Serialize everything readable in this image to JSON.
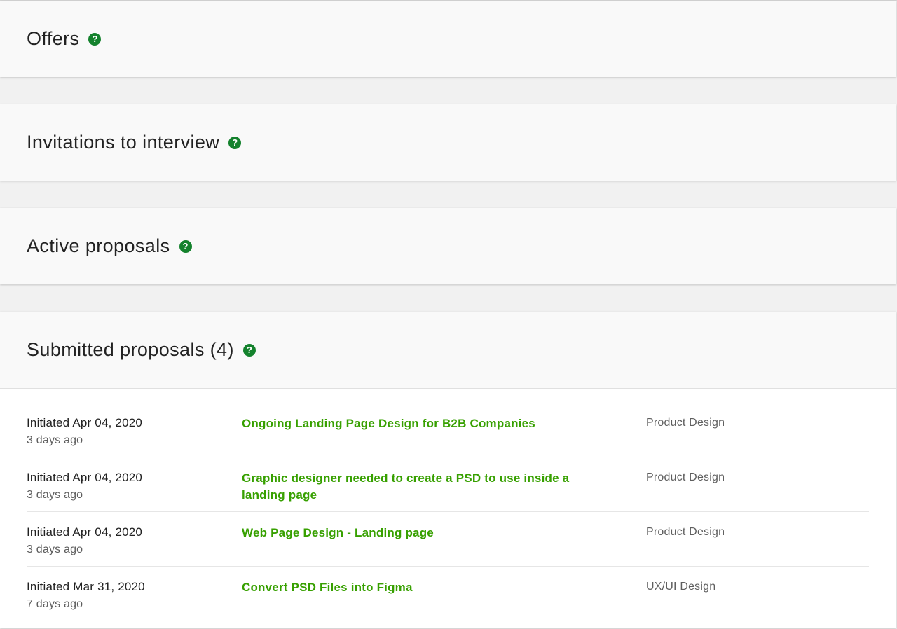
{
  "sections": {
    "offers": {
      "title": "Offers"
    },
    "invitations": {
      "title": "Invitations to interview"
    },
    "active": {
      "title": "Active proposals"
    },
    "submitted": {
      "title": "Submitted proposals (4)"
    }
  },
  "help_icon": {
    "glyph": "?",
    "icon": "question-circle-icon",
    "color": "#14822d"
  },
  "colors": {
    "link": "#37a000",
    "background": "#f1f1f1",
    "card": "#f9f9f9"
  },
  "submitted_proposals": [
    {
      "initiated": "Initiated Apr 04, 2020",
      "ago": "3 days ago",
      "title": "Ongoing Landing Page Design for B2B Companies",
      "category": "Product Design"
    },
    {
      "initiated": "Initiated Apr 04, 2020",
      "ago": "3 days ago",
      "title": "Graphic designer needed to create a PSD to use inside a landing page",
      "category": "Product Design"
    },
    {
      "initiated": "Initiated Apr 04, 2020",
      "ago": "3 days ago",
      "title": "Web Page Design - Landing page",
      "category": "Product Design"
    },
    {
      "initiated": "Initiated Mar 31, 2020",
      "ago": "7 days ago",
      "title": "Convert PSD Files into Figma",
      "category": "UX/UI Design"
    }
  ]
}
